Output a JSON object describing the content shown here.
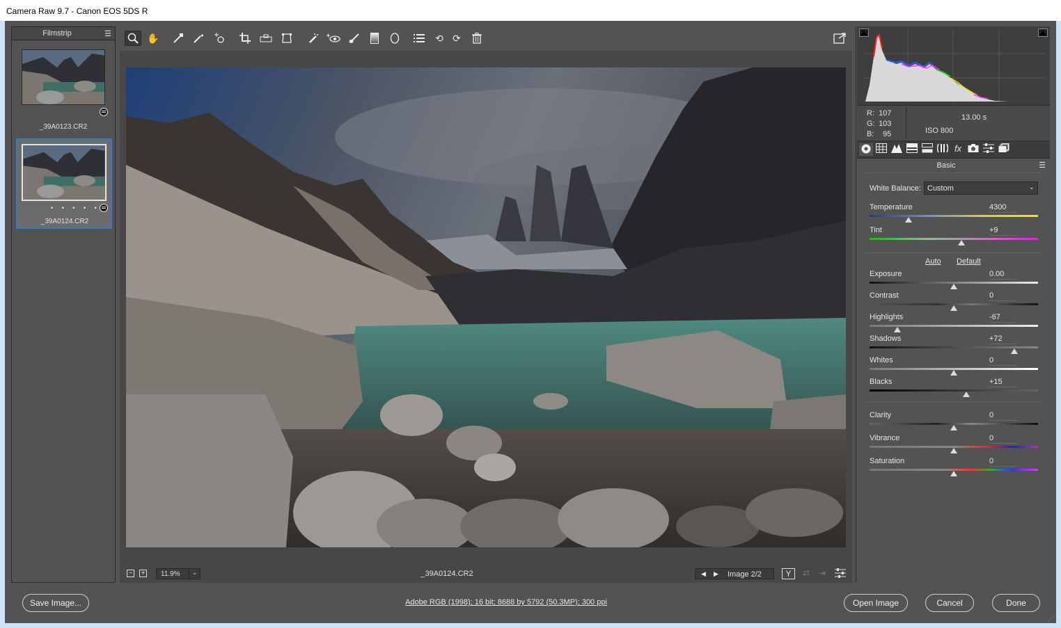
{
  "window": {
    "title": "Camera Raw 9.7  -  Canon EOS 5DS R"
  },
  "filmstrip": {
    "label": "Filmstrip",
    "items": [
      {
        "name": "_39A0123.CR2",
        "selected": false
      },
      {
        "name": "_39A0124.CR2",
        "selected": true,
        "rating_dots": "• • • • •"
      }
    ]
  },
  "toolbar": {
    "tools": [
      "zoom-tool",
      "hand-tool",
      "white-balance-tool",
      "color-sampler-tool",
      "targeted-adjustment-tool",
      "crop-tool",
      "straighten-tool",
      "transform-tool",
      "spot-removal-tool",
      "red-eye-removal-tool",
      "adjustment-brush-tool",
      "graduated-filter-tool",
      "radial-filter-tool",
      "open-preferences",
      "rotate-ccw",
      "rotate-cw",
      "trash"
    ]
  },
  "preview_footer": {
    "zoom": "11.9%",
    "filename": "_39A0124.CR2",
    "image_counter": "Image 2/2"
  },
  "info": {
    "r_label": "R:",
    "r": "107",
    "g_label": "G:",
    "g": "103",
    "b_label": "B:",
    "b": "95",
    "shutter": "13.00 s",
    "iso": "ISO 800"
  },
  "panel": {
    "title": "Basic",
    "white_balance_label": "White Balance:",
    "white_balance_value": "Custom",
    "auto_label": "Auto",
    "default_label": "Default",
    "sliders": [
      {
        "key": "temperature",
        "label": "Temperature",
        "value": "4300",
        "pos": 0.23
      },
      {
        "key": "tint",
        "label": "Tint",
        "value": "+9",
        "pos": 0.545
      },
      {
        "key": "exposure",
        "label": "Exposure",
        "value": "0.00",
        "pos": 0.5
      },
      {
        "key": "contrast",
        "label": "Contrast",
        "value": "0",
        "pos": 0.5
      },
      {
        "key": "highlights",
        "label": "Highlights",
        "value": "-67",
        "pos": 0.167
      },
      {
        "key": "shadows",
        "label": "Shadows",
        "value": "+72",
        "pos": 0.86
      },
      {
        "key": "whites",
        "label": "Whites",
        "value": "0",
        "pos": 0.5
      },
      {
        "key": "blacks",
        "label": "Blacks",
        "value": "+15",
        "pos": 0.575
      },
      {
        "key": "clarity",
        "label": "Clarity",
        "value": "0",
        "pos": 0.5
      },
      {
        "key": "vibrance",
        "label": "Vibrance",
        "value": "0",
        "pos": 0.5
      },
      {
        "key": "saturation",
        "label": "Saturation",
        "value": "0",
        "pos": 0.5
      }
    ]
  },
  "bottom": {
    "save_label": "Save Image...",
    "workflow_link": "Adobe RGB (1998); 16 bit; 8688 by 5792 (50.3MP); 300 ppi",
    "open_label": "Open Image",
    "cancel_label": "Cancel",
    "done_label": "Done"
  }
}
